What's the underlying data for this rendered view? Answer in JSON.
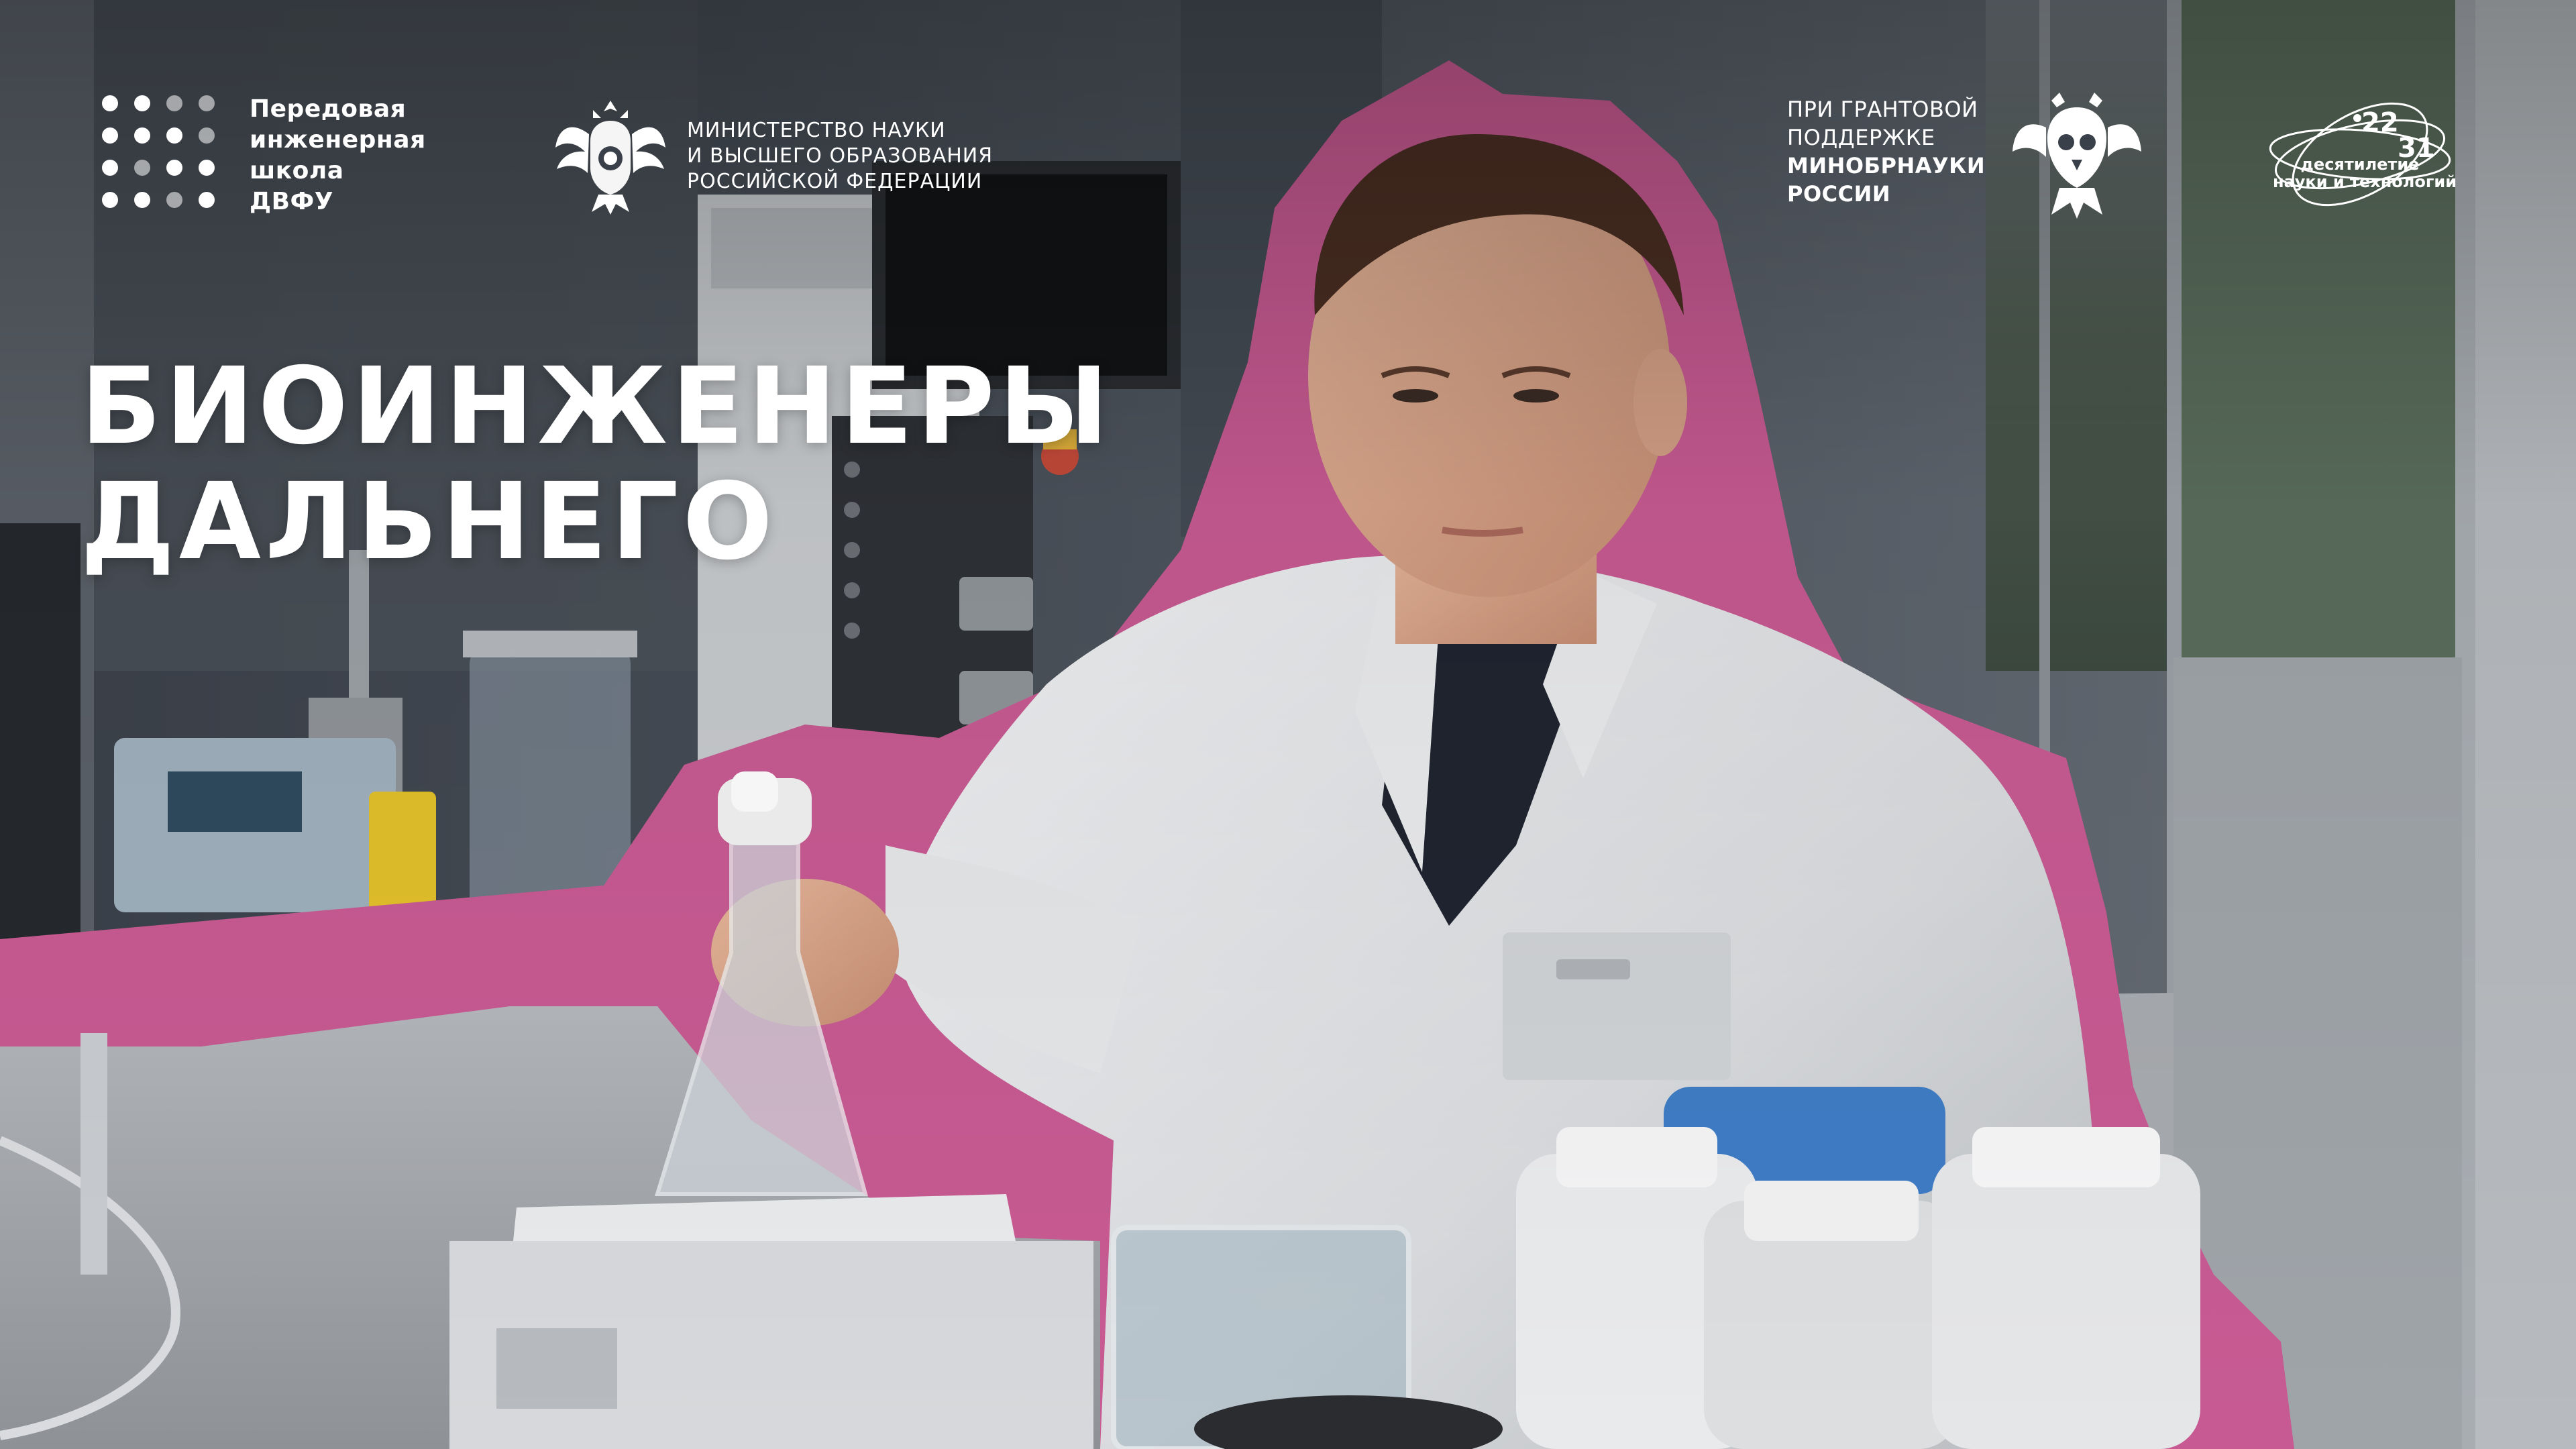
{
  "pish_logo": {
    "line1": "Передовая",
    "line2": "инженерная",
    "line3": "школа",
    "line4": "ДВФУ",
    "icon": "dots-grid-icon"
  },
  "ministry_logo": {
    "line1": "МИНИСТЕРСТВО НАУКИ",
    "line2": "И ВЫСШЕГО ОБРАЗОВАНИЯ",
    "line3": "РОССИЙСКОЙ ФЕДЕРАЦИИ",
    "icon": "double-headed-eagle-icon"
  },
  "grant_logo": {
    "line1": "ПРИ ГРАНТОВОЙ",
    "line2": "ПОДДЕРЖКЕ",
    "line3": "МИНОБРНАУКИ",
    "line4": "РОССИИ",
    "icon": "stylized-eagle-icon"
  },
  "decade_logo": {
    "year_start": "22",
    "year_end": "31",
    "line1": "десятилетие",
    "line2": "науки и технологий",
    "icon": "orbit-rings-icon"
  },
  "headline": {
    "line1": "БИОИНЖЕНЕРЫ",
    "line2": "ДАЛЬНЕГО"
  },
  "colors": {
    "accent_pink": "#c75a92",
    "overlay_text": "#ffffff",
    "background_dark": "#2b3038"
  }
}
